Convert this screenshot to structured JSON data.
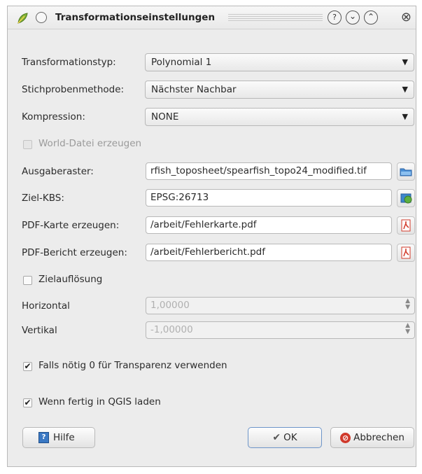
{
  "window": {
    "title": "Transformationseinstellungen",
    "title_icons": [
      "qgis-leaf-icon",
      "window-menu-icon"
    ],
    "controls": {
      "help_glyph": "?",
      "minimize_glyph": "⌄",
      "maximize_glyph": "⌃",
      "close_glyph": "⊗"
    }
  },
  "form": {
    "transform_type": {
      "label": "Transformationstyp:",
      "value": "Polynomial 1"
    },
    "resampling": {
      "label": "Stichprobenmethode:",
      "value": "Nächster Nachbar"
    },
    "compression": {
      "label": "Kompression:",
      "value": "NONE"
    },
    "world_file": {
      "label": "World-Datei erzeugen",
      "checked": false,
      "enabled": false
    },
    "output_raster": {
      "label": "Ausgaberaster:",
      "value": "rfish_toposheet/spearfish_topo24_modified.tif"
    },
    "target_crs": {
      "label": "Ziel-KBS:",
      "value": "EPSG:26713"
    },
    "pdf_map": {
      "label": "PDF-Karte erzeugen:",
      "value": "/arbeit/Fehlerkarte.pdf"
    },
    "pdf_report": {
      "label": "PDF-Bericht erzeugen:",
      "value": "/arbeit/Fehlerbericht.pdf"
    },
    "target_resolution": {
      "label": "Zielauflösung",
      "checked": false
    },
    "horizontal": {
      "label": "Horizontal",
      "value": "1,00000"
    },
    "vertical": {
      "label": "Vertikal",
      "value": "-1,00000"
    },
    "transparency": {
      "label": "Falls nötig 0 für Transparenz verwenden",
      "checked": true
    },
    "load_in_qgis": {
      "label": "Wenn fertig in QGIS laden",
      "checked": true
    }
  },
  "buttons": {
    "help": "Hilfe",
    "ok": "OK",
    "cancel": "Abbrechen"
  },
  "glyphs": {
    "dropdown": "▼",
    "check": "✔",
    "spin_up": "▲",
    "spin_down": "▼"
  },
  "colors": {
    "accent": "#3a78c3",
    "pdf_red": "#d23a2a",
    "window_bg": "#ececec"
  }
}
